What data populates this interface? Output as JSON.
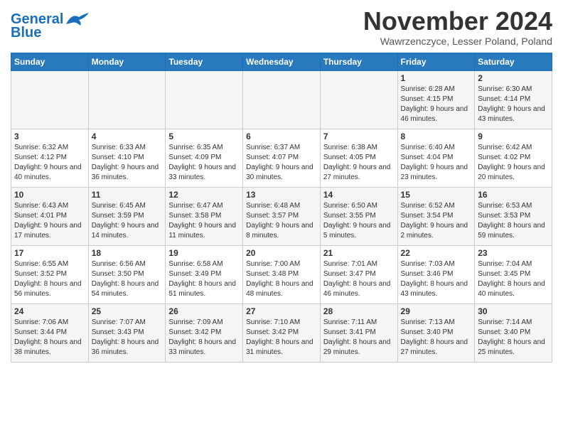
{
  "header": {
    "logo_line1": "General",
    "logo_line2": "Blue",
    "month_title": "November 2024",
    "location": "Wawrzenczyce, Lesser Poland, Poland"
  },
  "weekdays": [
    "Sunday",
    "Monday",
    "Tuesday",
    "Wednesday",
    "Thursday",
    "Friday",
    "Saturday"
  ],
  "weeks": [
    [
      {
        "day": "",
        "info": ""
      },
      {
        "day": "",
        "info": ""
      },
      {
        "day": "",
        "info": ""
      },
      {
        "day": "",
        "info": ""
      },
      {
        "day": "",
        "info": ""
      },
      {
        "day": "1",
        "info": "Sunrise: 6:28 AM\nSunset: 4:15 PM\nDaylight: 9 hours and 46 minutes."
      },
      {
        "day": "2",
        "info": "Sunrise: 6:30 AM\nSunset: 4:14 PM\nDaylight: 9 hours and 43 minutes."
      }
    ],
    [
      {
        "day": "3",
        "info": "Sunrise: 6:32 AM\nSunset: 4:12 PM\nDaylight: 9 hours and 40 minutes."
      },
      {
        "day": "4",
        "info": "Sunrise: 6:33 AM\nSunset: 4:10 PM\nDaylight: 9 hours and 36 minutes."
      },
      {
        "day": "5",
        "info": "Sunrise: 6:35 AM\nSunset: 4:09 PM\nDaylight: 9 hours and 33 minutes."
      },
      {
        "day": "6",
        "info": "Sunrise: 6:37 AM\nSunset: 4:07 PM\nDaylight: 9 hours and 30 minutes."
      },
      {
        "day": "7",
        "info": "Sunrise: 6:38 AM\nSunset: 4:05 PM\nDaylight: 9 hours and 27 minutes."
      },
      {
        "day": "8",
        "info": "Sunrise: 6:40 AM\nSunset: 4:04 PM\nDaylight: 9 hours and 23 minutes."
      },
      {
        "day": "9",
        "info": "Sunrise: 6:42 AM\nSunset: 4:02 PM\nDaylight: 9 hours and 20 minutes."
      }
    ],
    [
      {
        "day": "10",
        "info": "Sunrise: 6:43 AM\nSunset: 4:01 PM\nDaylight: 9 hours and 17 minutes."
      },
      {
        "day": "11",
        "info": "Sunrise: 6:45 AM\nSunset: 3:59 PM\nDaylight: 9 hours and 14 minutes."
      },
      {
        "day": "12",
        "info": "Sunrise: 6:47 AM\nSunset: 3:58 PM\nDaylight: 9 hours and 11 minutes."
      },
      {
        "day": "13",
        "info": "Sunrise: 6:48 AM\nSunset: 3:57 PM\nDaylight: 9 hours and 8 minutes."
      },
      {
        "day": "14",
        "info": "Sunrise: 6:50 AM\nSunset: 3:55 PM\nDaylight: 9 hours and 5 minutes."
      },
      {
        "day": "15",
        "info": "Sunrise: 6:52 AM\nSunset: 3:54 PM\nDaylight: 9 hours and 2 minutes."
      },
      {
        "day": "16",
        "info": "Sunrise: 6:53 AM\nSunset: 3:53 PM\nDaylight: 8 hours and 59 minutes."
      }
    ],
    [
      {
        "day": "17",
        "info": "Sunrise: 6:55 AM\nSunset: 3:52 PM\nDaylight: 8 hours and 56 minutes."
      },
      {
        "day": "18",
        "info": "Sunrise: 6:56 AM\nSunset: 3:50 PM\nDaylight: 8 hours and 54 minutes."
      },
      {
        "day": "19",
        "info": "Sunrise: 6:58 AM\nSunset: 3:49 PM\nDaylight: 8 hours and 51 minutes."
      },
      {
        "day": "20",
        "info": "Sunrise: 7:00 AM\nSunset: 3:48 PM\nDaylight: 8 hours and 48 minutes."
      },
      {
        "day": "21",
        "info": "Sunrise: 7:01 AM\nSunset: 3:47 PM\nDaylight: 8 hours and 46 minutes."
      },
      {
        "day": "22",
        "info": "Sunrise: 7:03 AM\nSunset: 3:46 PM\nDaylight: 8 hours and 43 minutes."
      },
      {
        "day": "23",
        "info": "Sunrise: 7:04 AM\nSunset: 3:45 PM\nDaylight: 8 hours and 40 minutes."
      }
    ],
    [
      {
        "day": "24",
        "info": "Sunrise: 7:06 AM\nSunset: 3:44 PM\nDaylight: 8 hours and 38 minutes."
      },
      {
        "day": "25",
        "info": "Sunrise: 7:07 AM\nSunset: 3:43 PM\nDaylight: 8 hours and 36 minutes."
      },
      {
        "day": "26",
        "info": "Sunrise: 7:09 AM\nSunset: 3:42 PM\nDaylight: 8 hours and 33 minutes."
      },
      {
        "day": "27",
        "info": "Sunrise: 7:10 AM\nSunset: 3:42 PM\nDaylight: 8 hours and 31 minutes."
      },
      {
        "day": "28",
        "info": "Sunrise: 7:11 AM\nSunset: 3:41 PM\nDaylight: 8 hours and 29 minutes."
      },
      {
        "day": "29",
        "info": "Sunrise: 7:13 AM\nSunset: 3:40 PM\nDaylight: 8 hours and 27 minutes."
      },
      {
        "day": "30",
        "info": "Sunrise: 7:14 AM\nSunset: 3:40 PM\nDaylight: 8 hours and 25 minutes."
      }
    ]
  ]
}
